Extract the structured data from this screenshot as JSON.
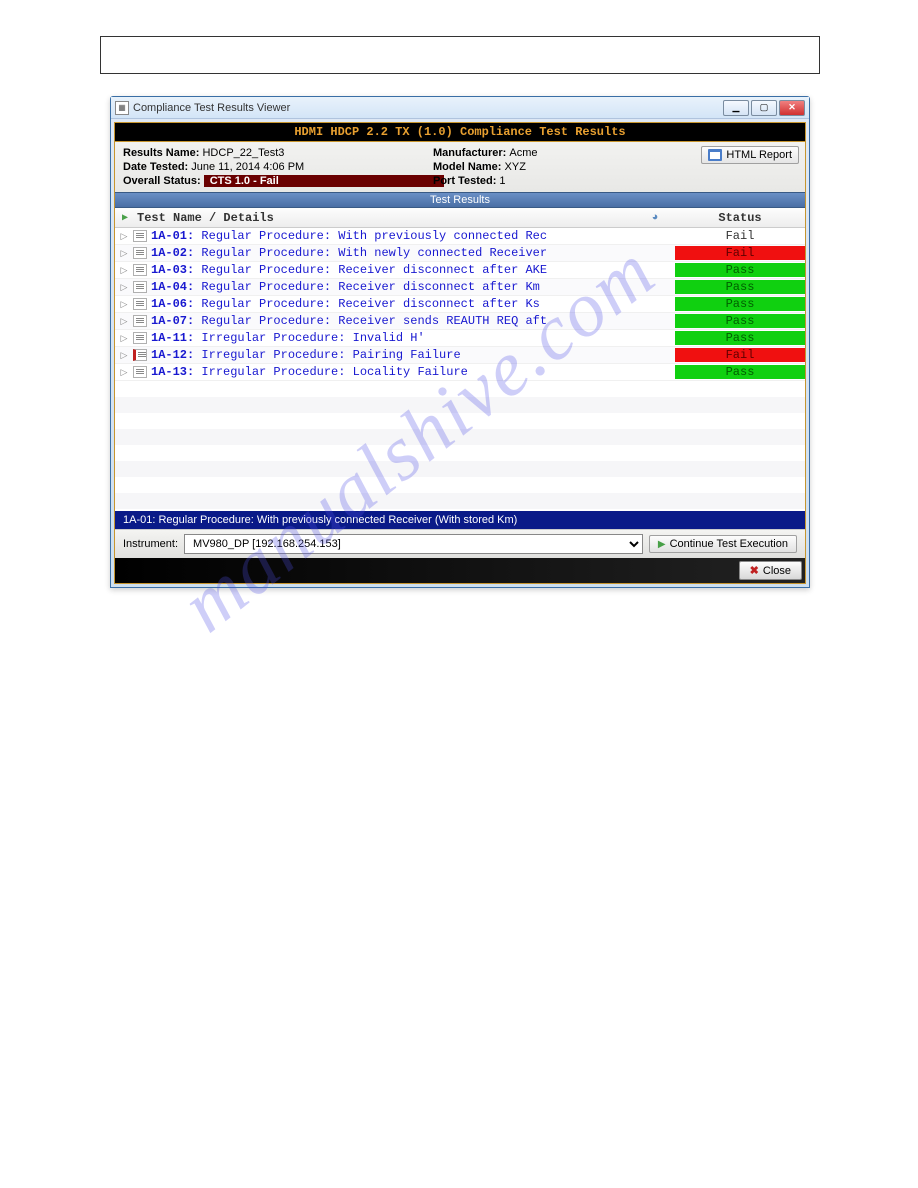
{
  "page_header_box": "",
  "window": {
    "title": "Compliance Test Results Viewer",
    "banner": "HDMI HDCP 2.2 TX (1.0) Compliance Test Results",
    "info": {
      "results_name_label": "Results Name: ",
      "results_name_value": "HDCP_22_Test3",
      "date_tested_label": "Date Tested: ",
      "date_tested_value": "June 11, 2014 4:06 PM",
      "overall_status_label": "Overall Status: ",
      "overall_status_value": "CTS 1.0 - Fail",
      "manufacturer_label": "Manufacturer: ",
      "manufacturer_value": "Acme",
      "model_name_label": "Model Name: ",
      "model_name_value": "XYZ",
      "port_tested_label": "Port Tested: ",
      "port_tested_value": "1"
    },
    "html_report_label": "HTML Report",
    "section_header": "Test Results",
    "columns": {
      "name": "Test Name / Details",
      "status": "Status"
    },
    "rows": [
      {
        "id": "1A-01",
        "name": "Regular Procedure: With previously connected Rec",
        "status": "Fail",
        "status_class": "plain",
        "icon_fail": false
      },
      {
        "id": "1A-02",
        "name": "Regular Procedure: With newly connected Receiver",
        "status": "Fail",
        "status_class": "fail",
        "icon_fail": false
      },
      {
        "id": "1A-03",
        "name": "Regular Procedure: Receiver disconnect after AKE",
        "status": "Pass",
        "status_class": "pass",
        "icon_fail": false
      },
      {
        "id": "1A-04",
        "name": "Regular Procedure: Receiver disconnect after Km",
        "status": "Pass",
        "status_class": "pass",
        "icon_fail": false
      },
      {
        "id": "1A-06",
        "name": "Regular Procedure: Receiver disconnect after Ks",
        "status": "Pass",
        "status_class": "pass",
        "icon_fail": false
      },
      {
        "id": "1A-07",
        "name": "Regular Procedure: Receiver sends REAUTH REQ aft",
        "status": "Pass",
        "status_class": "pass",
        "icon_fail": false
      },
      {
        "id": "1A-11",
        "name": "Irregular Procedure: Invalid H'",
        "status": "Pass",
        "status_class": "pass",
        "icon_fail": false
      },
      {
        "id": "1A-12",
        "name": "Irregular Procedure: Pairing Failure",
        "status": "Fail",
        "status_class": "fail",
        "icon_fail": true
      },
      {
        "id": "1A-13",
        "name": "Irregular Procedure: Locality Failure",
        "status": "Pass",
        "status_class": "pass",
        "icon_fail": false
      }
    ],
    "selected_detail": "1A-01: Regular Procedure: With previously connected Receiver (With stored Km)",
    "instrument_label": "Instrument:",
    "instrument_value": "MV980_DP [192.168.254.153]",
    "continue_label": "Continue Test Execution",
    "close_label": "Close"
  },
  "watermark": "manualshive.com"
}
